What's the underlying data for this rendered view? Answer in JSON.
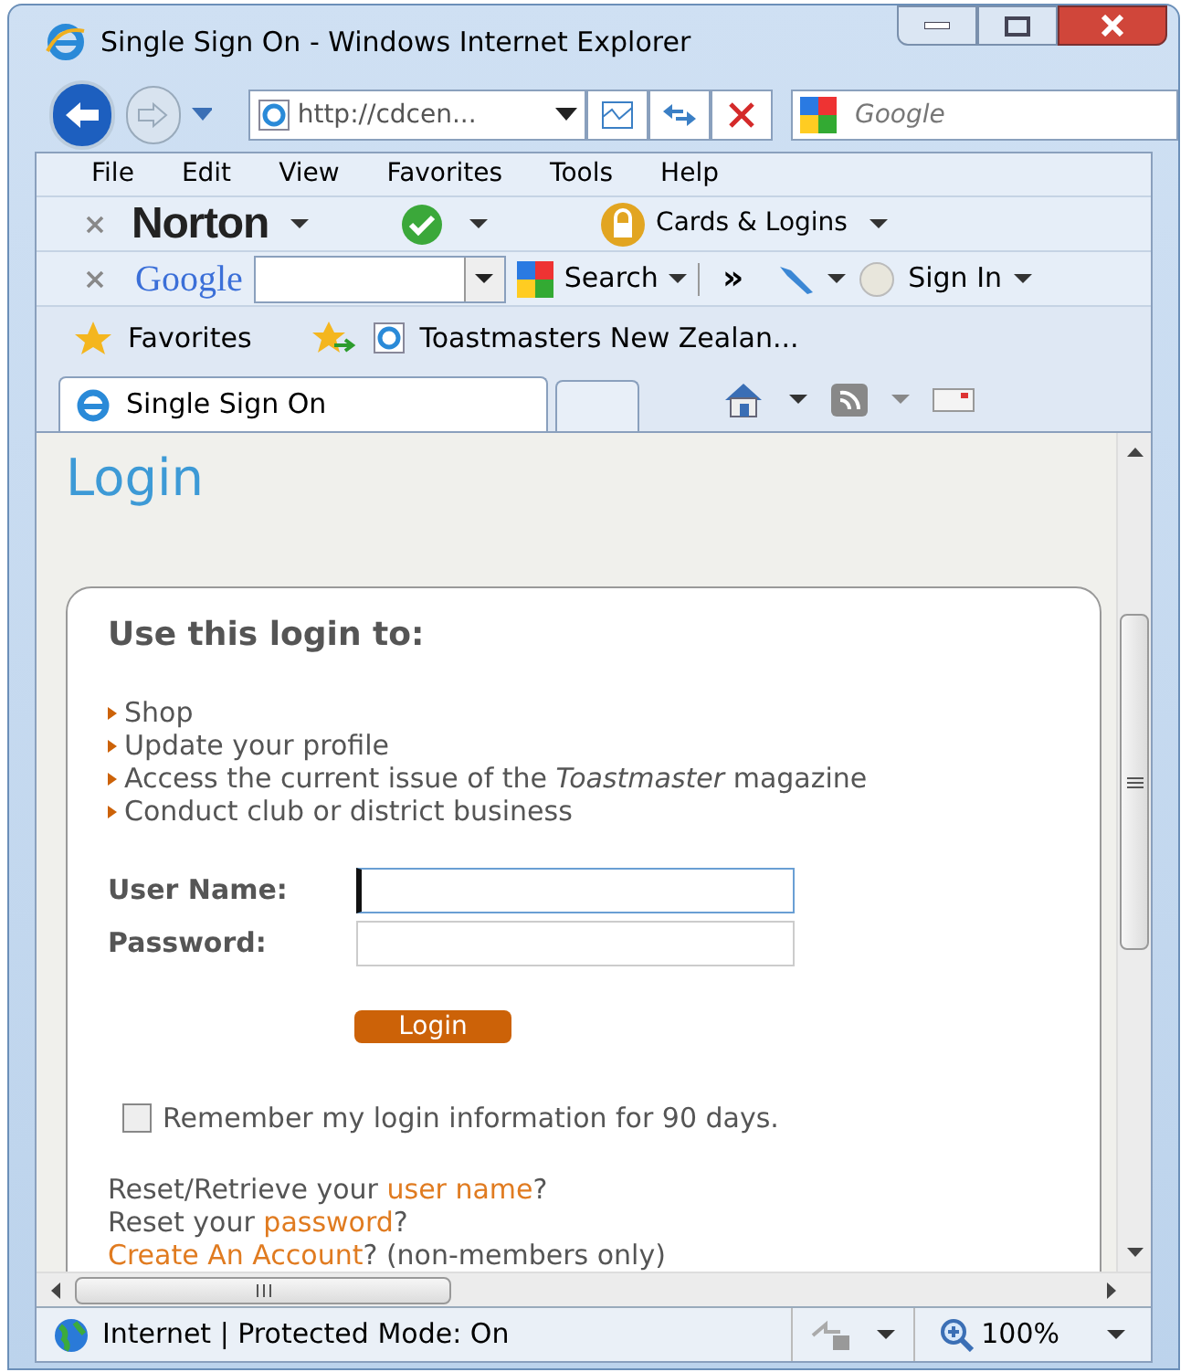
{
  "window": {
    "title": "Single Sign On - Windows Internet Explorer"
  },
  "address_bar": {
    "value": "http://cdcen..."
  },
  "search_box": {
    "placeholder": "Google"
  },
  "menu": [
    "File",
    "Edit",
    "View",
    "Favorites",
    "Tools",
    "Help"
  ],
  "norton_toolbar": {
    "brand": "Norton",
    "cards": "Cards & Logins"
  },
  "google_toolbar": {
    "brand": "Google",
    "search": "Search",
    "more": "»",
    "sign_in": "Sign In"
  },
  "favorites_bar": {
    "favorites": "Favorites",
    "links": [
      "Toastmasters New Zealan..."
    ]
  },
  "tabs": [
    {
      "label": "Single Sign On",
      "selected": true
    }
  ],
  "page": {
    "heading": "Login",
    "card": {
      "title": "Use this login to:",
      "items": [
        "Shop",
        "Update your profile",
        "Access the current issue of the *Toastmaster* magazine",
        "Conduct club or district business"
      ],
      "fields": [
        {
          "label": "User Name:",
          "focused": true
        },
        {
          "label": "Password:",
          "focused": false
        }
      ],
      "button": "Login",
      "remember": {
        "label": "Remember my login information for 90 days.",
        "checked": false
      },
      "links": [
        [
          {
            "kind": "text",
            "text": "Reset/Retrieve your "
          },
          {
            "kind": "link",
            "text": "user name"
          },
          {
            "kind": "text",
            "text": "?"
          }
        ],
        [
          {
            "kind": "text",
            "text": "Reset your "
          },
          {
            "kind": "link",
            "text": "password"
          },
          {
            "kind": "text",
            "text": "?"
          }
        ],
        [
          {
            "kind": "link",
            "text": "Create An Account"
          },
          {
            "kind": "text",
            "text": "? (non-members only)"
          }
        ]
      ]
    }
  },
  "status_bar": {
    "zone": "Internet | Protected Mode: On",
    "zoom": "100%"
  }
}
